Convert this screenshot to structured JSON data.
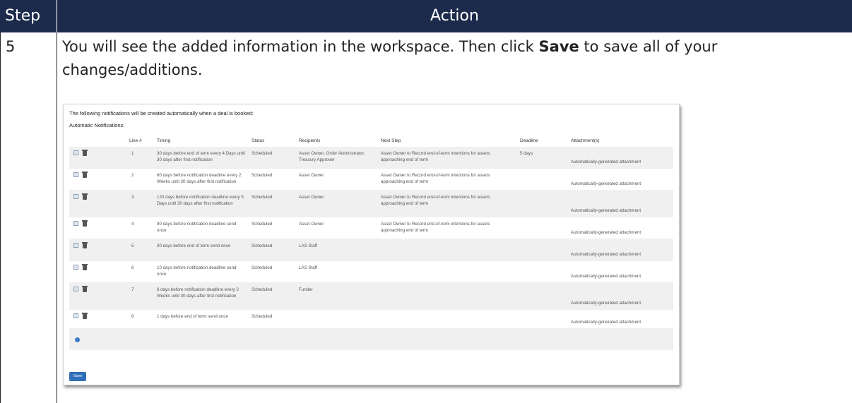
{
  "header": {
    "step_label": "Step",
    "action_label": "Action"
  },
  "step": {
    "number": "5",
    "text_before": "You will see the added information in the workspace. Then click ",
    "bold": "Save",
    "text_after": " to save all of your changes/additions."
  },
  "screenshot": {
    "intro": "The following notifications will be created automatically when a deal is booked:",
    "section_label": "Automatic Notifications:",
    "columns": {
      "line": "Line #",
      "timing": "Timing",
      "status": "Status",
      "recipients": "Recipients",
      "next_step": "Next Step",
      "deadline": "Deadline",
      "attachments": "Attachment(s)"
    },
    "rows": [
      {
        "line": "1",
        "timing": "30 days before end of term every 4 Days until 30 days after first notification",
        "status": "Scheduled",
        "recipients": "Asset Owner, Order Administrator, Treasury Approver",
        "next_step": "Asset Owner to Record end-of-term intentions for assets approaching end of term",
        "deadline": "5 days",
        "attachment": "Automatically-generated attachment"
      },
      {
        "line": "2",
        "timing": "60 days before notification deadline every 2 Weeks until 30 days after first notification",
        "status": "Scheduled",
        "recipients": "Asset Owner",
        "next_step": "Asset Owner to Record end-of-term intentions for assets approaching end of term",
        "deadline": "",
        "attachment": "Automatically-generated attachment"
      },
      {
        "line": "3",
        "timing": "120 days before notification deadline every 5 Days until 30 days after first notification",
        "status": "Scheduled",
        "recipients": "Asset Owner",
        "next_step": "Asset Owner to Record end-of-term intentions for assets approaching end of term",
        "deadline": "",
        "attachment": "Automatically-generated attachment"
      },
      {
        "line": "4",
        "timing": "90 days before notification deadline send once",
        "status": "Scheduled",
        "recipients": "Asset Owner",
        "next_step": "Asset Owner to Record end-of-term intentions for assets approaching end of term",
        "deadline": "",
        "attachment": "Automatically-generated attachment"
      },
      {
        "line": "5",
        "timing": "30 days before end of term send once",
        "status": "Scheduled",
        "recipients": "LAS Staff",
        "next_step": "",
        "deadline": "",
        "attachment": "Automatically-generated attachment"
      },
      {
        "line": "6",
        "timing": "10 days before notification deadline send once",
        "status": "Scheduled",
        "recipients": "LAS Staff",
        "next_step": "",
        "deadline": "",
        "attachment": "Automatically-generated attachment"
      },
      {
        "line": "7",
        "timing": "6 days before notification deadline every 2 Weeks until 30 days after first notification",
        "status": "Scheduled",
        "recipients": "Funder",
        "next_step": "",
        "deadline": "",
        "attachment": "Automatically-generated attachment"
      },
      {
        "line": "8",
        "timing": "1 days before end of term send once",
        "status": "Scheduled",
        "recipients": "",
        "next_step": "",
        "deadline": "",
        "attachment": "Automatically-generated attachment"
      }
    ],
    "save_label": "Save",
    "colors": {
      "header_bg": "#1c2a4c",
      "button": "#2f6fb8",
      "add_icon": "#3e7cc4"
    }
  }
}
